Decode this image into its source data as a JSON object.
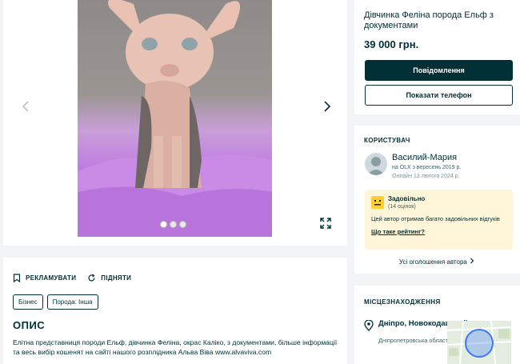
{
  "gallery": {
    "prev_icon": "chevron-left-icon",
    "next_icon": "chevron-right-icon",
    "expand_icon": "expand-icon"
  },
  "description_block": {
    "promote_label": "РЕКЛАМУВАТИ",
    "raise_label": "ПІДНЯТИ",
    "tags": [
      "Бізнес",
      "Порода: Інша"
    ],
    "heading": "ОПИС",
    "text": "Елітна представниця породи Ельф, дівчинка Феліна, окрас Каліко, з документами, більше інформації та весь вибір кошенят на сайті нашого розплідника Альва Віва www.alvaviva.com"
  },
  "listing": {
    "title": "Дівчинка Феліна порода Ельф з документами",
    "price": "39 000 грн.",
    "message_button": "Повідомлення",
    "phone_button": "Показати телефон"
  },
  "user": {
    "section_label": "КОРИСТУВАЧ",
    "name": "Василий-Мария",
    "since": "на OLX з вересень 2019 р.",
    "online": "Онлайн 13 лютого 2024 р.",
    "rating_label": "Задовільно",
    "rating_count": "(14 оцінок)",
    "rating_text": "Цей автор отримав багато задовільних відгуків",
    "rating_link": "Що таке рейтинг?",
    "all_ads": "Усі оголошення автора"
  },
  "location": {
    "section_label": "МІСЦЕЗНАХОДЖЕННЯ",
    "city": "Дніпро, Новокодацький",
    "region": "Дніпропетровська область"
  },
  "colors": {
    "brand": "#002f34",
    "background": "#f2f4f5",
    "rating_bg": "#fff6d9",
    "rating_face": "#ffce32"
  }
}
